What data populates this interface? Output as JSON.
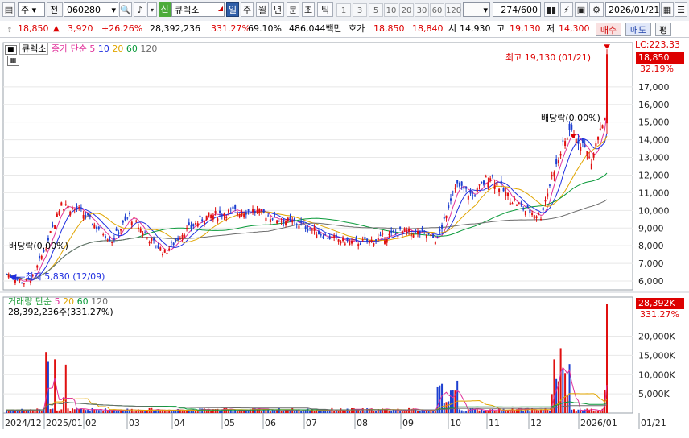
{
  "toolbar": {
    "market_label": "주",
    "prev_label": "전",
    "code": "060280",
    "new_badge": "신",
    "stock_name": "큐렉소",
    "periods": [
      "일",
      "주",
      "월",
      "년",
      "분",
      "초",
      "틱"
    ],
    "minute_buttons": [
      "1",
      "3",
      "5",
      "10",
      "20",
      "30",
      "60",
      "120"
    ],
    "count": "274",
    "count_max": "/600",
    "date": "2026/01/21"
  },
  "quote": {
    "price": "18,850",
    "change_arrow": "▲",
    "change": "3,920",
    "change_pct": "+26.26%",
    "volume": "28,392,236",
    "volume_ratio": "331.27%",
    "turnover": "69.10%",
    "amount": "486,044백만",
    "ask_label": "호가",
    "ask": "18,850",
    "bid": "18,840",
    "open_label": "시",
    "open": "14,930",
    "high_label": "고",
    "high": "19,130",
    "low_label": "저",
    "low": "14,300",
    "buy_label": "매수",
    "sell_label": "매도",
    "eval_label": "평"
  },
  "price_legend": {
    "name": "큐렉소",
    "series_label": "종가 단순",
    "ma": [
      "5",
      "10",
      "20",
      "60",
      "120"
    ],
    "colors": {
      "ma5": "#e0309a",
      "ma10": "#1f2ee0",
      "ma20": "#e1a500",
      "ma60": "#0a9a3a",
      "ma120": "#6b6b6b"
    }
  },
  "volume_legend": {
    "name": "거래량",
    "series_label": "단순",
    "ma": [
      "5",
      "20",
      "60",
      "120"
    ],
    "total": "28,392,236주(331.27%)"
  },
  "annotations": {
    "high_text": "최고 19,130 (01/21)",
    "low_text": "최저 5,830 (12/09)",
    "dividend1": "배당락(0.00%)",
    "dividend2": "배당락(0.00%)",
    "lc_label": "LC:223,33",
    "price_box": "18,850",
    "price_pct": "32.19%",
    "vol_box": "28,392K",
    "vol_pct": "331.27%"
  },
  "price_axis": [
    "17,000",
    "16,000",
    "15,000",
    "14,000",
    "13,000",
    "12,000",
    "11,000",
    "10,000",
    "9,000",
    "8,000",
    "7,000",
    "6,000"
  ],
  "volume_axis": [
    "20,000K",
    "15,000K",
    "10,000K",
    "5,000K"
  ],
  "date_axis": [
    "2024/12",
    "2025/01",
    "02",
    "03",
    "04",
    "05",
    "06",
    "07",
    "08",
    "09",
    "10",
    "11",
    "12",
    "2026/01",
    "01/21"
  ],
  "chart_data": {
    "type": "candlestick",
    "x": [
      "2024/12",
      "2025/01",
      "2025/02",
      "2025/03",
      "2025/04",
      "2025/05",
      "2025/06",
      "2025/07",
      "2025/08",
      "2025/09",
      "2025/10",
      "2025/11",
      "2025/12",
      "2026/01"
    ],
    "ylim": [
      5500,
      19500
    ],
    "series": [
      {
        "name": "종가",
        "values": [
          6300,
          9900,
          10300,
          8400,
          8300,
          9500,
          9800,
          9300,
          8200,
          8600,
          11300,
          10400,
          13600,
          18850
        ]
      }
    ],
    "volume_unit": "K",
    "volume_ylim": [
      0,
      28500
    ]
  }
}
